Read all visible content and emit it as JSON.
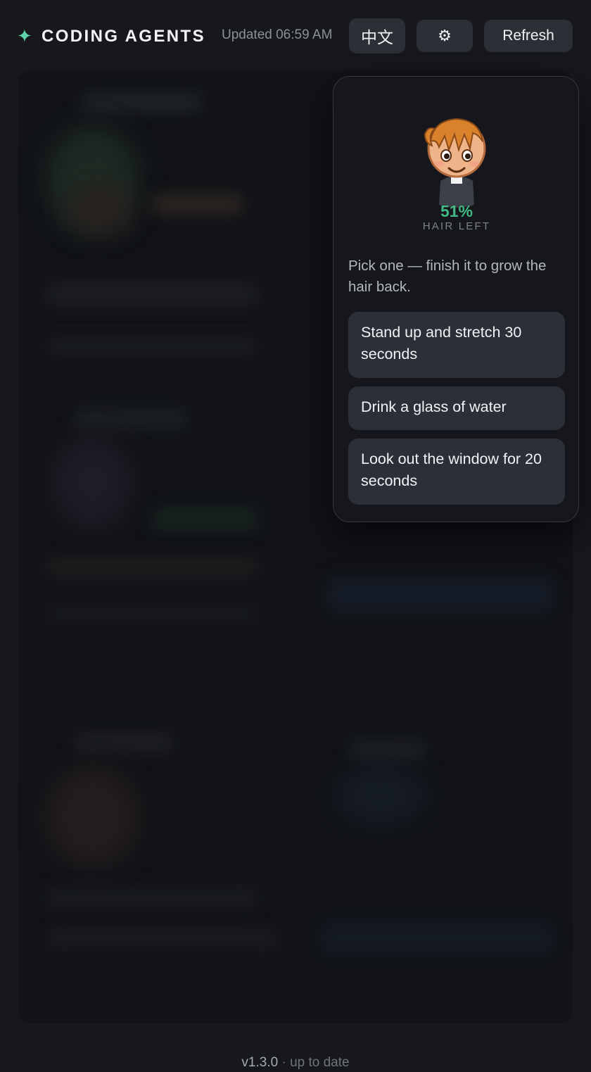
{
  "header": {
    "logo_icon": "sparkle-icon",
    "title": "CODING AGENTS",
    "updated": "Updated 06:59 AM",
    "lang_button": "中文",
    "settings_icon": "gear-icon",
    "settings_glyph": "⚙",
    "refresh_button": "Refresh"
  },
  "popover": {
    "avatar_icon": "balding-character-icon",
    "hair_percent": "51%",
    "hair_value": 0.51,
    "hair_label": "HAIR LEFT",
    "prompt": "Pick one — finish it to grow the hair back.",
    "choices": [
      "Stand up and stretch 30 seconds",
      "Drink a glass of water",
      "Look out the window for 20 seconds"
    ]
  },
  "footer": {
    "version": "v1.3.0",
    "separator": " · ",
    "status": "up to date"
  },
  "colors": {
    "background": "#16181c",
    "accent_green": "#42b883",
    "button_bg": "#2c2f36"
  }
}
